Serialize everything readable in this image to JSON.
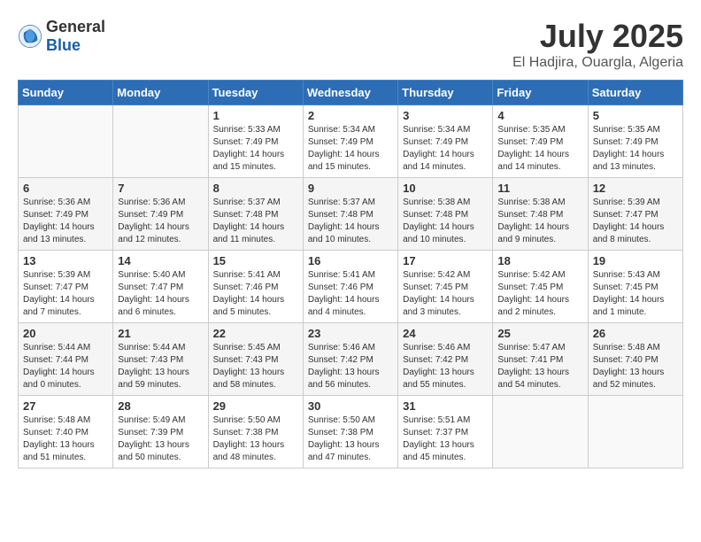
{
  "header": {
    "logo_general": "General",
    "logo_blue": "Blue",
    "month_year": "July 2025",
    "location": "El Hadjira, Ouargla, Algeria"
  },
  "weekdays": [
    "Sunday",
    "Monday",
    "Tuesday",
    "Wednesday",
    "Thursday",
    "Friday",
    "Saturday"
  ],
  "weeks": [
    [
      {
        "day": "",
        "sunrise": "",
        "sunset": "",
        "daylight": ""
      },
      {
        "day": "",
        "sunrise": "",
        "sunset": "",
        "daylight": ""
      },
      {
        "day": "1",
        "sunrise": "Sunrise: 5:33 AM",
        "sunset": "Sunset: 7:49 PM",
        "daylight": "Daylight: 14 hours and 15 minutes."
      },
      {
        "day": "2",
        "sunrise": "Sunrise: 5:34 AM",
        "sunset": "Sunset: 7:49 PM",
        "daylight": "Daylight: 14 hours and 15 minutes."
      },
      {
        "day": "3",
        "sunrise": "Sunrise: 5:34 AM",
        "sunset": "Sunset: 7:49 PM",
        "daylight": "Daylight: 14 hours and 14 minutes."
      },
      {
        "day": "4",
        "sunrise": "Sunrise: 5:35 AM",
        "sunset": "Sunset: 7:49 PM",
        "daylight": "Daylight: 14 hours and 14 minutes."
      },
      {
        "day": "5",
        "sunrise": "Sunrise: 5:35 AM",
        "sunset": "Sunset: 7:49 PM",
        "daylight": "Daylight: 14 hours and 13 minutes."
      }
    ],
    [
      {
        "day": "6",
        "sunrise": "Sunrise: 5:36 AM",
        "sunset": "Sunset: 7:49 PM",
        "daylight": "Daylight: 14 hours and 13 minutes."
      },
      {
        "day": "7",
        "sunrise": "Sunrise: 5:36 AM",
        "sunset": "Sunset: 7:49 PM",
        "daylight": "Daylight: 14 hours and 12 minutes."
      },
      {
        "day": "8",
        "sunrise": "Sunrise: 5:37 AM",
        "sunset": "Sunset: 7:48 PM",
        "daylight": "Daylight: 14 hours and 11 minutes."
      },
      {
        "day": "9",
        "sunrise": "Sunrise: 5:37 AM",
        "sunset": "Sunset: 7:48 PM",
        "daylight": "Daylight: 14 hours and 10 minutes."
      },
      {
        "day": "10",
        "sunrise": "Sunrise: 5:38 AM",
        "sunset": "Sunset: 7:48 PM",
        "daylight": "Daylight: 14 hours and 10 minutes."
      },
      {
        "day": "11",
        "sunrise": "Sunrise: 5:38 AM",
        "sunset": "Sunset: 7:48 PM",
        "daylight": "Daylight: 14 hours and 9 minutes."
      },
      {
        "day": "12",
        "sunrise": "Sunrise: 5:39 AM",
        "sunset": "Sunset: 7:47 PM",
        "daylight": "Daylight: 14 hours and 8 minutes."
      }
    ],
    [
      {
        "day": "13",
        "sunrise": "Sunrise: 5:39 AM",
        "sunset": "Sunset: 7:47 PM",
        "daylight": "Daylight: 14 hours and 7 minutes."
      },
      {
        "day": "14",
        "sunrise": "Sunrise: 5:40 AM",
        "sunset": "Sunset: 7:47 PM",
        "daylight": "Daylight: 14 hours and 6 minutes."
      },
      {
        "day": "15",
        "sunrise": "Sunrise: 5:41 AM",
        "sunset": "Sunset: 7:46 PM",
        "daylight": "Daylight: 14 hours and 5 minutes."
      },
      {
        "day": "16",
        "sunrise": "Sunrise: 5:41 AM",
        "sunset": "Sunset: 7:46 PM",
        "daylight": "Daylight: 14 hours and 4 minutes."
      },
      {
        "day": "17",
        "sunrise": "Sunrise: 5:42 AM",
        "sunset": "Sunset: 7:45 PM",
        "daylight": "Daylight: 14 hours and 3 minutes."
      },
      {
        "day": "18",
        "sunrise": "Sunrise: 5:42 AM",
        "sunset": "Sunset: 7:45 PM",
        "daylight": "Daylight: 14 hours and 2 minutes."
      },
      {
        "day": "19",
        "sunrise": "Sunrise: 5:43 AM",
        "sunset": "Sunset: 7:45 PM",
        "daylight": "Daylight: 14 hours and 1 minute."
      }
    ],
    [
      {
        "day": "20",
        "sunrise": "Sunrise: 5:44 AM",
        "sunset": "Sunset: 7:44 PM",
        "daylight": "Daylight: 14 hours and 0 minutes."
      },
      {
        "day": "21",
        "sunrise": "Sunrise: 5:44 AM",
        "sunset": "Sunset: 7:43 PM",
        "daylight": "Daylight: 13 hours and 59 minutes."
      },
      {
        "day": "22",
        "sunrise": "Sunrise: 5:45 AM",
        "sunset": "Sunset: 7:43 PM",
        "daylight": "Daylight: 13 hours and 58 minutes."
      },
      {
        "day": "23",
        "sunrise": "Sunrise: 5:46 AM",
        "sunset": "Sunset: 7:42 PM",
        "daylight": "Daylight: 13 hours and 56 minutes."
      },
      {
        "day": "24",
        "sunrise": "Sunrise: 5:46 AM",
        "sunset": "Sunset: 7:42 PM",
        "daylight": "Daylight: 13 hours and 55 minutes."
      },
      {
        "day": "25",
        "sunrise": "Sunrise: 5:47 AM",
        "sunset": "Sunset: 7:41 PM",
        "daylight": "Daylight: 13 hours and 54 minutes."
      },
      {
        "day": "26",
        "sunrise": "Sunrise: 5:48 AM",
        "sunset": "Sunset: 7:40 PM",
        "daylight": "Daylight: 13 hours and 52 minutes."
      }
    ],
    [
      {
        "day": "27",
        "sunrise": "Sunrise: 5:48 AM",
        "sunset": "Sunset: 7:40 PM",
        "daylight": "Daylight: 13 hours and 51 minutes."
      },
      {
        "day": "28",
        "sunrise": "Sunrise: 5:49 AM",
        "sunset": "Sunset: 7:39 PM",
        "daylight": "Daylight: 13 hours and 50 minutes."
      },
      {
        "day": "29",
        "sunrise": "Sunrise: 5:50 AM",
        "sunset": "Sunset: 7:38 PM",
        "daylight": "Daylight: 13 hours and 48 minutes."
      },
      {
        "day": "30",
        "sunrise": "Sunrise: 5:50 AM",
        "sunset": "Sunset: 7:38 PM",
        "daylight": "Daylight: 13 hours and 47 minutes."
      },
      {
        "day": "31",
        "sunrise": "Sunrise: 5:51 AM",
        "sunset": "Sunset: 7:37 PM",
        "daylight": "Daylight: 13 hours and 45 minutes."
      },
      {
        "day": "",
        "sunrise": "",
        "sunset": "",
        "daylight": ""
      },
      {
        "day": "",
        "sunrise": "",
        "sunset": "",
        "daylight": ""
      }
    ]
  ]
}
